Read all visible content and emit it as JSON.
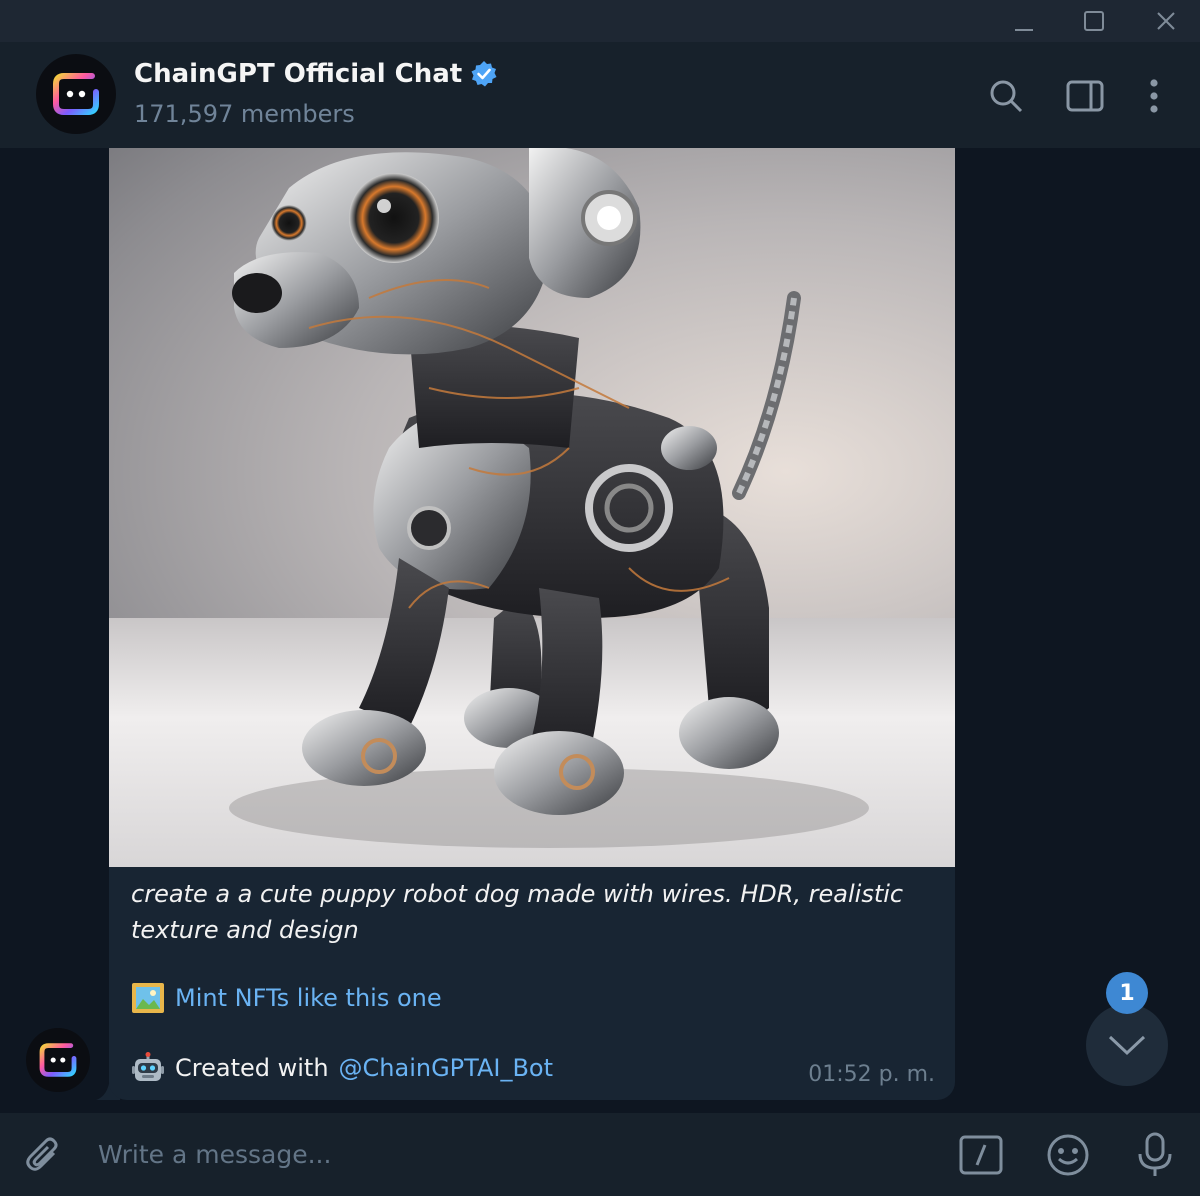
{
  "window": {
    "controls": [
      "minimize-icon",
      "maximize-icon",
      "close-icon"
    ]
  },
  "header": {
    "title": "ChainGPT Official Chat",
    "subtitle": "171,597 members",
    "verified": true,
    "icons": [
      "search-icon",
      "sidebar-toggle-icon",
      "more-vertical-icon"
    ]
  },
  "message": {
    "caption": "create a a cute puppy robot dog made with wires. HDR, realistic texture and design",
    "mint_emoji": "framed-picture-icon",
    "mint_link": "Mint NFTs like this one",
    "created_emoji": "robot-icon",
    "created_prefix": "Created with",
    "created_link": "@ChainGPTAI_Bot",
    "time": "01:52 p. m."
  },
  "scroll": {
    "unread_count": "1"
  },
  "composer": {
    "placeholder": "Write a message..."
  },
  "colors": {
    "background": "#0e1621",
    "header": "#17212b",
    "bubble": "#182533",
    "link": "#6ab3f3",
    "badge": "#3e88d3"
  }
}
